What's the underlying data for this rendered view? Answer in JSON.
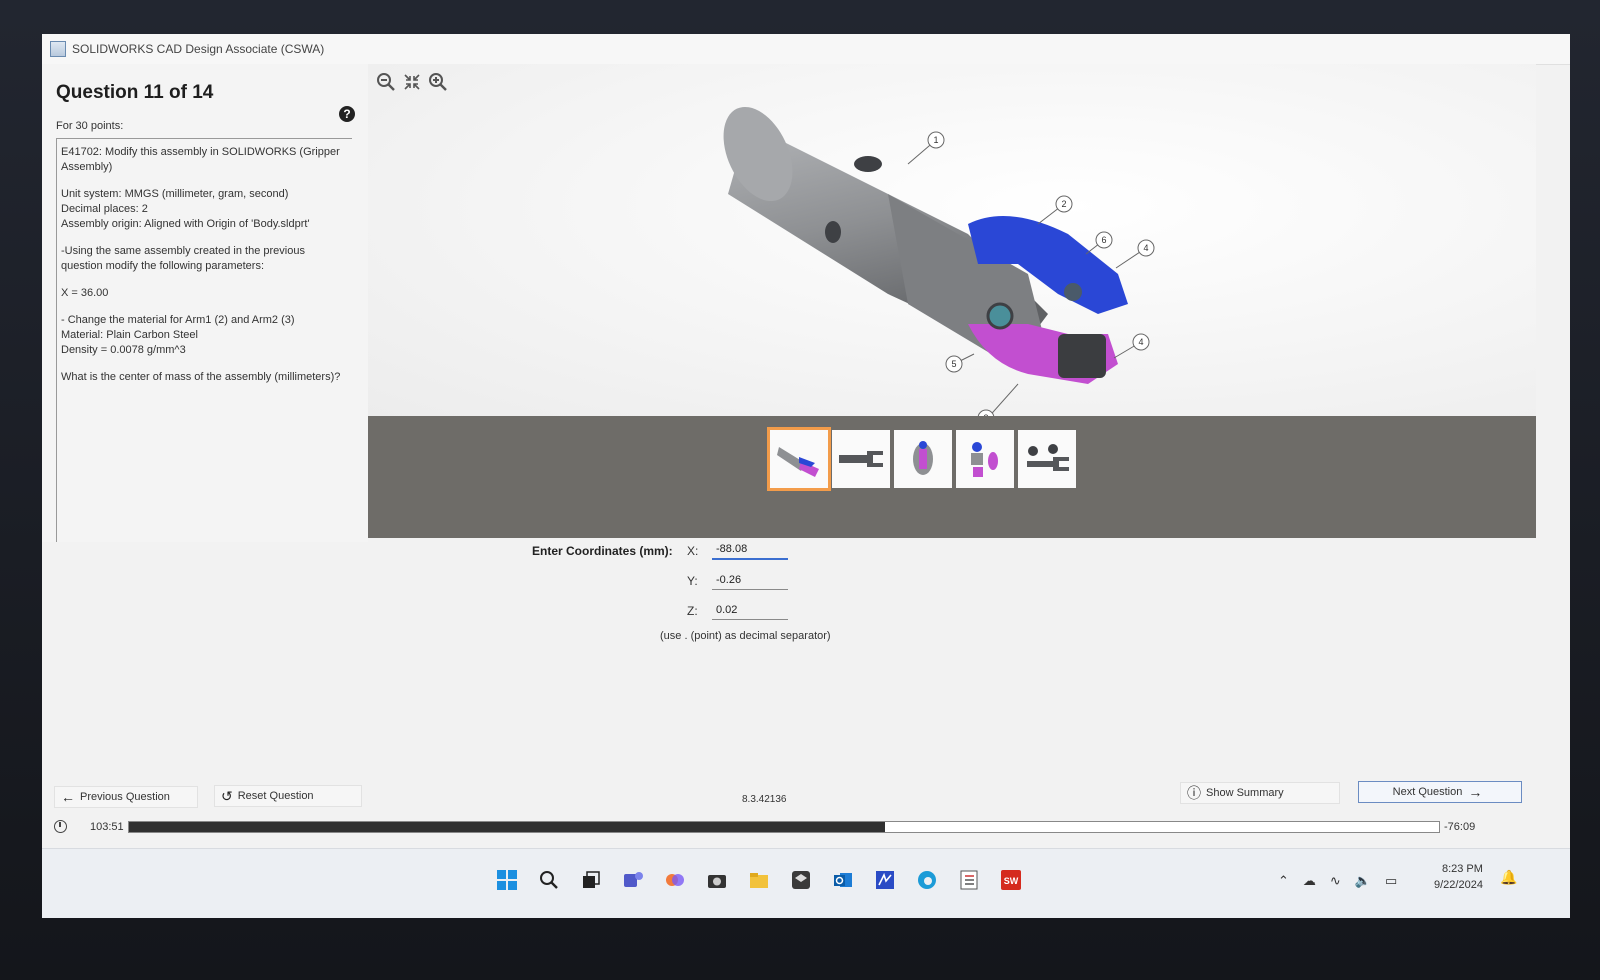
{
  "window": {
    "title": "SOLIDWORKS CAD Design Associate (CSWA)"
  },
  "question": {
    "heading": "Question 11 of 14",
    "points": "For 30 points:",
    "help_icon": "help-circle-icon",
    "paragraphs": [
      "E41702:  Modify this assembly in SOLIDWORKS (Gripper Assembly)",
      "Unit system: MMGS (millimeter, gram, second)\nDecimal places: 2\nAssembly origin: Aligned with Origin of 'Body.sldprt'",
      "-Using the same assembly created in the previous question modify the following parameters:",
      "X = 36.00",
      "- Change the material for Arm1 (2) and Arm2 (3)\nMaterial: Plain Carbon Steel\nDensity = 0.0078 g/mm^3",
      "What is the center of mass of the assembly (millimeters)?"
    ]
  },
  "viewer": {
    "zoom_tools": [
      "zoom-out-icon",
      "fit-icon",
      "zoom-in-icon"
    ],
    "callouts": [
      "1",
      "2",
      "6",
      "4",
      "4",
      "5",
      "3",
      "6"
    ],
    "thumbnails": [
      "assembly-isometric",
      "arm-side",
      "body-front",
      "exploded-view",
      "parts-layout"
    ]
  },
  "answer": {
    "label": "Enter Coordinates (mm):",
    "x_label": "X:",
    "x_value": "-88.08",
    "y_label": "Y:",
    "y_value": "-0.26",
    "z_label": "Z:",
    "z_value": "0.02",
    "hint": "(use . (point) as decimal separator)"
  },
  "nav": {
    "previous": "Previous Question",
    "reset": "Reset Question",
    "summary": "Show Summary",
    "next": "Next Question",
    "version": "8.3.42136"
  },
  "timer": {
    "elapsed": "103:51",
    "remaining": "-76:09",
    "progress_fraction": 0.577
  },
  "taskbar": {
    "icons": [
      "windows-start-icon",
      "search-icon",
      "task-view-icon",
      "teams-icon",
      "copilot-icon",
      "camera-icon",
      "file-explorer-icon",
      "app-cube-icon",
      "outlook-icon",
      "mathcad-icon",
      "edge-icon",
      "checklist-icon",
      "solidworks-icon"
    ],
    "time": "8:23 PM",
    "date": "9/22/2024"
  },
  "colors": {
    "arm_blue": "#2a47d6",
    "arm_magenta": "#c24fd0",
    "body_gray": "#8e9093",
    "selected_thumb": "#f39c4a",
    "progress": "#303030"
  }
}
